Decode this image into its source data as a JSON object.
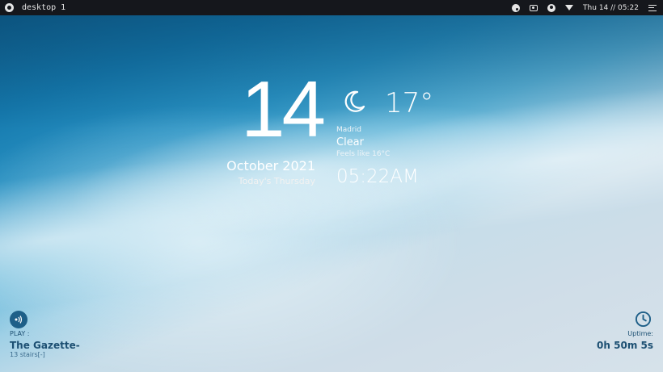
{
  "topbar": {
    "workspace_label": "desktop 1",
    "clock": "Thu 14 // 05:22",
    "icons": [
      "distro-logo-icon",
      "palette-icon",
      "camera-icon",
      "user-icon",
      "wifi-icon",
      "menu-icon"
    ]
  },
  "date_widget": {
    "day": "14",
    "month_year": "October 2021",
    "weekday_line": "Today's Thursday"
  },
  "weather_widget": {
    "icon": "moon-icon",
    "temperature": "17°",
    "city": "Madrid",
    "condition": "Clear",
    "feels_like": "Feels like 16°C",
    "time": "05:22AM"
  },
  "music_widget": {
    "icon": "speaker-icon",
    "label": "PLAY :",
    "title": "The Gazette-",
    "artist": "13 stairs[-]"
  },
  "uptime_widget": {
    "icon": "clock-icon",
    "label": "Uptime:",
    "value": "0h 50m 5s"
  },
  "colors": {
    "bar_bg": "#15171c",
    "accent": "#1e5f88",
    "text_light": "#ffffff"
  }
}
